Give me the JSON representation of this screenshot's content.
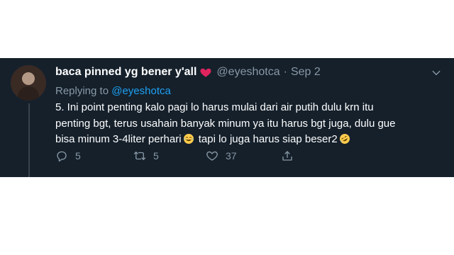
{
  "tweet": {
    "display_name": "baca pinned yg bener y'all",
    "handle": "@eyeshotca",
    "separator": "·",
    "date": "Sep 2",
    "replying_to_label": "Replying to",
    "replying_to_handle": "@eyeshotca",
    "text_line1": "5. Ini point penting kalo pagi lo harus mulai dari air putih dulu krn itu",
    "text_line2": "penting bgt, terus usahain banyak minum ya itu harus bgt juga, dulu gue",
    "text_line3a": "bisa minum 3-4liter perhari",
    "text_line3b": "tapi lo juga harus siap beser2",
    "reply_count": "5",
    "retweet_count": "5",
    "like_count": "37",
    "icons": {
      "name_badge": "red-heart-icon",
      "menu": "chevron-down-icon",
      "emoji1": "tears-of-joy-emoji-icon",
      "emoji2": "rolling-on-floor-laughing-emoji-icon",
      "reply": "reply-icon",
      "retweet": "retweet-icon",
      "like": "heart-outline-icon",
      "share": "share-icon"
    }
  },
  "colors": {
    "background": "#15202b",
    "text": "#ffffff",
    "muted": "#8899a6",
    "link": "#1da1f2",
    "heart": "#e0245e"
  }
}
